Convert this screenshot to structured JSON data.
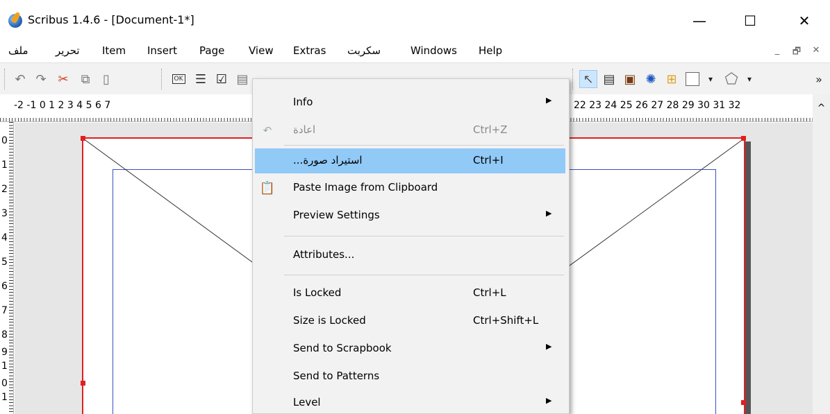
{
  "window": {
    "title": "Scribus 1.4.6 - [Document-1*]",
    "minimize_glyph": "—",
    "maximize_glyph": "☐",
    "close_glyph": "✕"
  },
  "menubar": {
    "items": [
      "ملف",
      "تحرير",
      "Item",
      "Insert",
      "Page",
      "View",
      "Extras",
      "سكربت",
      "Windows",
      "Help"
    ],
    "mdi_controls": [
      "_",
      "🗗",
      "✕"
    ]
  },
  "toolbar": {
    "more_glyph": "»",
    "dropdown_glyph": "▾"
  },
  "ruler": {
    "h_left": "-2  -1  0  1  2  3  4  5  6  7",
    "h_right": "22 23 24 25 26 27 28 29 30 31 32",
    "v_numbers": [
      "0",
      "1",
      "2",
      "3",
      "4",
      "5",
      "6",
      "7",
      "8",
      "9",
      "1",
      "0",
      "1"
    ],
    "scroll_up_glyph": "^"
  },
  "context_menu": {
    "items": [
      {
        "label": "Info",
        "shortcut": "",
        "submenu": true
      },
      {
        "label": "اعادة",
        "shortcut": "Ctrl+Z",
        "disabled": true,
        "icon": "redo-icon"
      },
      {
        "label": "...استيراد صورة",
        "shortcut": "Ctrl+I",
        "highlighted": true
      },
      {
        "label": "Paste Image from Clipboard",
        "shortcut": "",
        "icon": "clipboard-icon"
      },
      {
        "label": "Preview Settings",
        "shortcut": "",
        "submenu": true
      },
      {
        "label": "Attributes...",
        "shortcut": ""
      },
      {
        "label": "Is Locked",
        "shortcut": "Ctrl+L"
      },
      {
        "label": "Size is Locked",
        "shortcut": "Ctrl+Shift+L"
      },
      {
        "label": "Send to Scrapbook",
        "shortcut": "",
        "submenu": true
      },
      {
        "label": "Send to Patterns",
        "shortcut": ""
      },
      {
        "label": "Level",
        "shortcut": "",
        "submenu": true
      }
    ],
    "submenu_arrow": "▶"
  },
  "colors": {
    "highlight": "#91c9f7",
    "page_border": "#e02020",
    "margin_guide": "#3a4fc0"
  }
}
